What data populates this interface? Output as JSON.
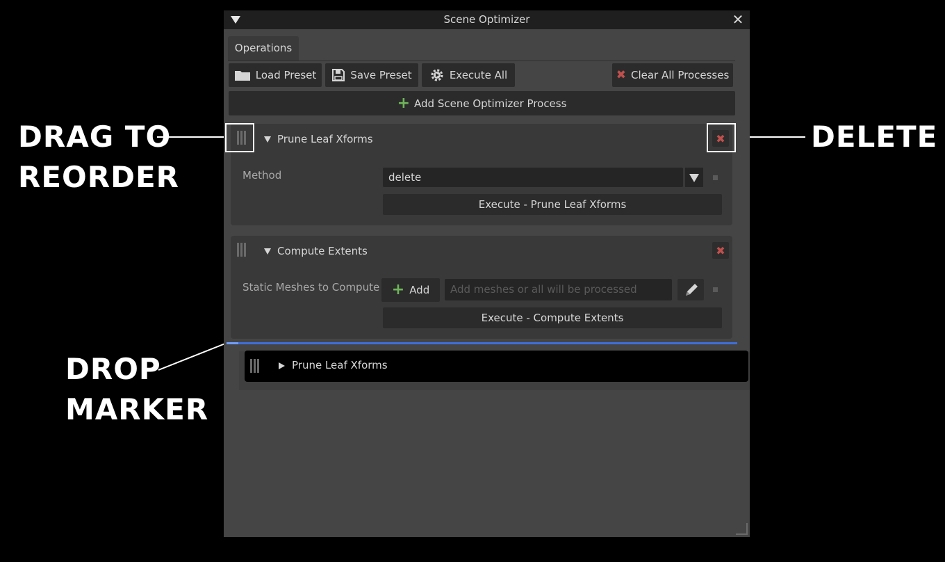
{
  "window": {
    "title": "Scene Optimizer",
    "tab": "Operations"
  },
  "toolbar": {
    "load_preset": "Load Preset",
    "save_preset": "Save Preset",
    "execute_all": "Execute All",
    "clear_all": "Clear All Processes",
    "add_process": "Add Scene Optimizer Process"
  },
  "processes": [
    {
      "title": "Prune Leaf Xforms",
      "field_label": "Method",
      "field_value": "delete",
      "execute_label": "Execute - Prune Leaf Xforms"
    },
    {
      "title": "Compute Extents",
      "field_label": "Static Meshes to Compute",
      "add_label": "Add",
      "placeholder": "Add meshes or all will be processed",
      "execute_label": "Execute - Compute Extents"
    }
  ],
  "dragging": {
    "title": "Prune Leaf Xforms"
  },
  "annotations": {
    "drag_line1": "DRAG TO",
    "drag_line2": "REORDER",
    "delete": "DELETE",
    "drop_line1": "DROP",
    "drop_line2": "MARKER"
  },
  "colors": {
    "delete_red": "#c0504d",
    "add_green": "#6fb55a",
    "drop_marker_blue": "#3f6ed9"
  }
}
